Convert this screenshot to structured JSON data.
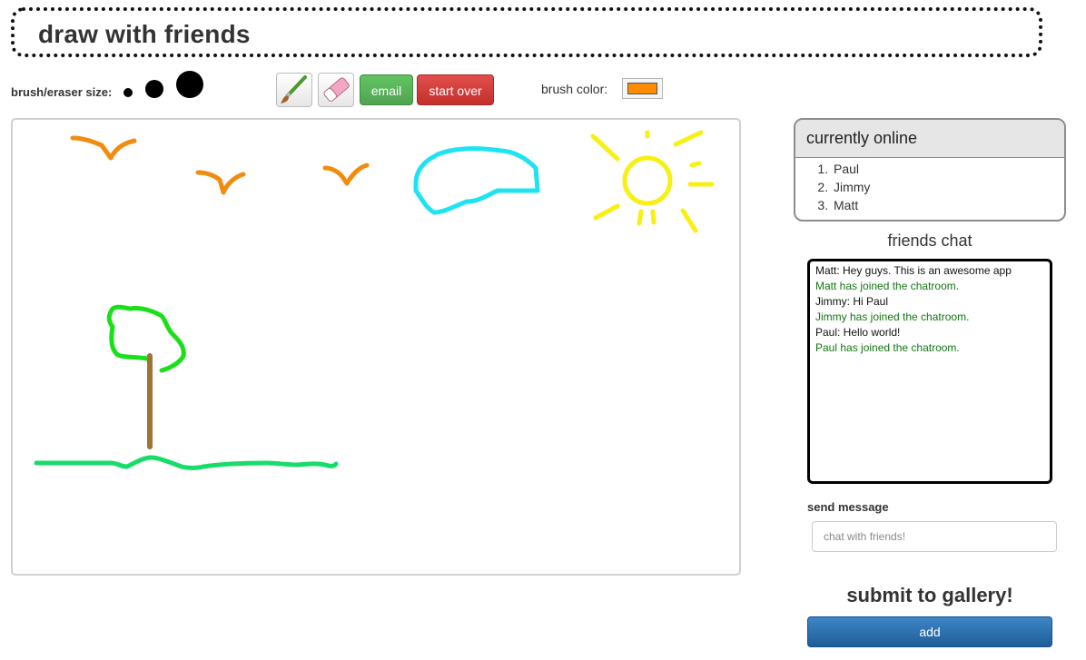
{
  "app": {
    "title": "draw with friends"
  },
  "toolbar": {
    "size_label": "brush/eraser size:",
    "sizes": [
      "small",
      "medium",
      "large"
    ],
    "brush_tool_icon": "paintbrush-icon",
    "eraser_tool_icon": "eraser-icon",
    "email_label": "email",
    "start_over_label": "start over",
    "brush_color_label": "brush color:",
    "brush_color": "#ff8c00"
  },
  "online": {
    "header": "currently online",
    "users": [
      "Paul",
      "Jimmy",
      "Matt"
    ]
  },
  "chat": {
    "title": "friends chat",
    "messages": [
      {
        "type": "msg",
        "text": "Matt: Hey guys. This is an awesome app"
      },
      {
        "type": "system",
        "text": "Matt has joined the chatroom."
      },
      {
        "type": "msg",
        "text": "Jimmy: Hi Paul"
      },
      {
        "type": "system",
        "text": "Jimmy has joined the chatroom."
      },
      {
        "type": "msg",
        "text": "Paul: Hello world!"
      },
      {
        "type": "system",
        "text": "Paul has joined the chatroom."
      }
    ],
    "send_label": "send message",
    "input_placeholder": "chat with friends!",
    "input_value": ""
  },
  "gallery": {
    "title": "submit to gallery!",
    "add_label": "add"
  },
  "colors": {
    "bird": "#f28c0f",
    "cloud": "#1ee3f0",
    "sun": "#f8f013",
    "tree_top": "#19e019",
    "trunk": "#a07436",
    "grass": "#16dc6a",
    "email_button": "#51a351",
    "start_over_button": "#c4302b",
    "add_button": "#2a6aa8",
    "system_message": "#117711"
  }
}
